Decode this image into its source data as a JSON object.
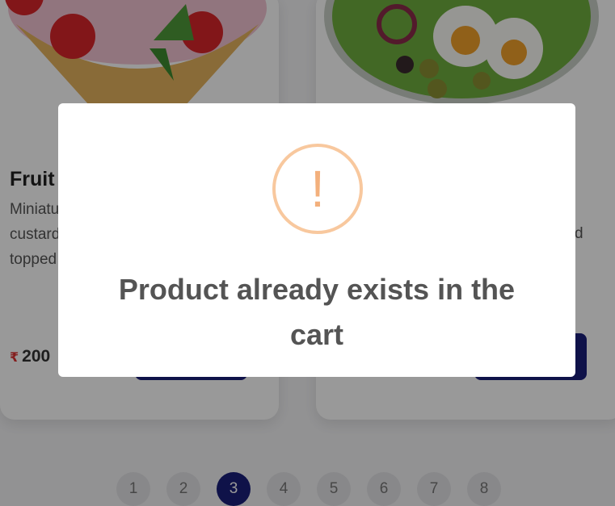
{
  "cards": [
    {
      "title": "Fruit",
      "description": "Miniatu\ncustard\ntopped",
      "currency_symbol": "₹",
      "price": "200",
      "image": "ice-cream-waffle-cone-with-strawberries"
    },
    {
      "title": "",
      "description": "d",
      "image": "salad-bowl-with-eggs-olives-onions"
    }
  ],
  "pagination": {
    "pages": [
      "1",
      "2",
      "3",
      "4",
      "5",
      "6",
      "7",
      "8"
    ],
    "current": "3"
  },
  "modal": {
    "icon": "exclamation-icon",
    "message": "Product already exists in the cart"
  },
  "colors": {
    "primary_button": "#1a1f7a",
    "warning_ring": "#f8c89e",
    "warning_glyph": "#f3b07c",
    "price_currency": "#dd3333"
  }
}
